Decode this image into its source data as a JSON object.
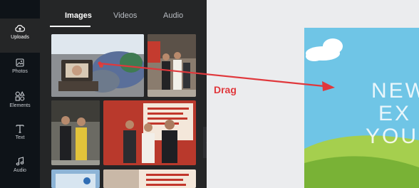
{
  "sidebar": {
    "items": [
      {
        "label": "Uploads",
        "icon": "cloud-upload-icon",
        "active": true
      },
      {
        "label": "Photos",
        "icon": "photo-icon",
        "active": false
      },
      {
        "label": "Elements",
        "icon": "elements-icon",
        "active": false
      },
      {
        "label": "Text",
        "icon": "text-icon",
        "active": false
      },
      {
        "label": "Audio",
        "icon": "music-note-icon",
        "active": false
      }
    ]
  },
  "tabs": [
    {
      "label": "Images",
      "active": true
    },
    {
      "label": "Videos",
      "active": false
    },
    {
      "label": "Audio",
      "active": false
    }
  ],
  "annotation": {
    "label": "Drag",
    "color": "#e0383c"
  },
  "design": {
    "line1": "NEW",
    "line2": "EX",
    "line3": "YOU"
  },
  "colors": {
    "rail": "#0e1318",
    "panel": "#252627",
    "canvas": "#ebecee",
    "design_sky": "#6fc5e6",
    "design_hill": "#8ec13f"
  }
}
